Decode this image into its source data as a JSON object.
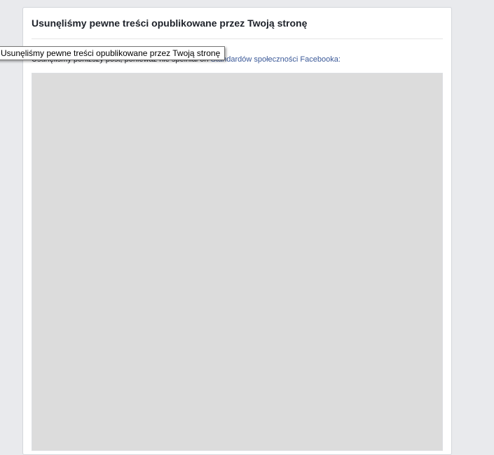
{
  "panel": {
    "title": "Usunęliśmy pewne treści opublikowane przez Twoją stronę",
    "message_prefix": "Usunęliśmy poniższy post, ponieważ nie spełniał on",
    "message_link": "Standardów społeczności Facebooka:"
  },
  "tooltip": {
    "text": "Usunęliśmy pewne treści opublikowane przez Twoją stronę"
  },
  "colors": {
    "background": "#e9eaed",
    "panel": "#ffffff",
    "link": "#3b5998"
  }
}
